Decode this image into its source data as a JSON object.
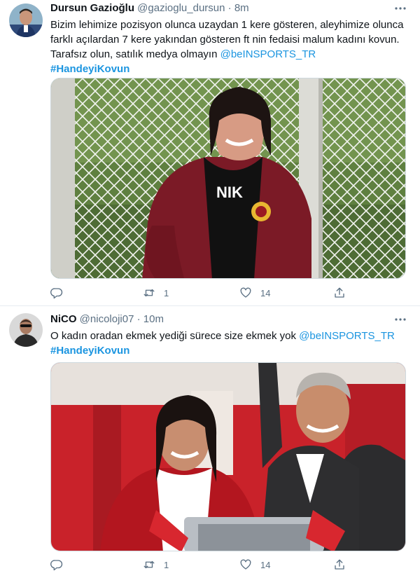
{
  "tweets": [
    {
      "author": {
        "name": "Dursun Gazioğlu",
        "handle": "@gazioglu_dursun",
        "separator": "·",
        "time": "8m"
      },
      "more_icon": "more-horizontal-icon",
      "text": {
        "line1": "Bizim lehimize pozisyon olunca uzaydan 1 kere gösteren, aleyhimize olunca",
        "line2": "farklı açılardan 7 kere yakından gösteren ft nin fedaisi malum kadını kovun.",
        "line3": "Tarafsız olun, satılık medya olmayın",
        "mention": "@beINSPORTS_TR",
        "hashtag": "#HandeyiKovun"
      },
      "actions": {
        "reply_count": "",
        "retweet_count": "1",
        "like_count": "14"
      }
    },
    {
      "author": {
        "name": "NiCO",
        "handle": "@nicoloji07",
        "separator": "·",
        "time": "10m"
      },
      "more_icon": "more-horizontal-icon",
      "text": {
        "line1": "O kadın oradan ekmek yediği sürece size ekmek yok",
        "mention": "@beINSPORTS_TR",
        "hashtag": "#HandeyiKovun"
      },
      "actions": {
        "reply_count": "",
        "retweet_count": "1",
        "like_count": "14"
      }
    }
  ],
  "colors": {
    "link": "#1b95e0",
    "secondary_text": "#5b7083",
    "primary_text": "#0f1419",
    "divider": "#e6ecf0"
  }
}
